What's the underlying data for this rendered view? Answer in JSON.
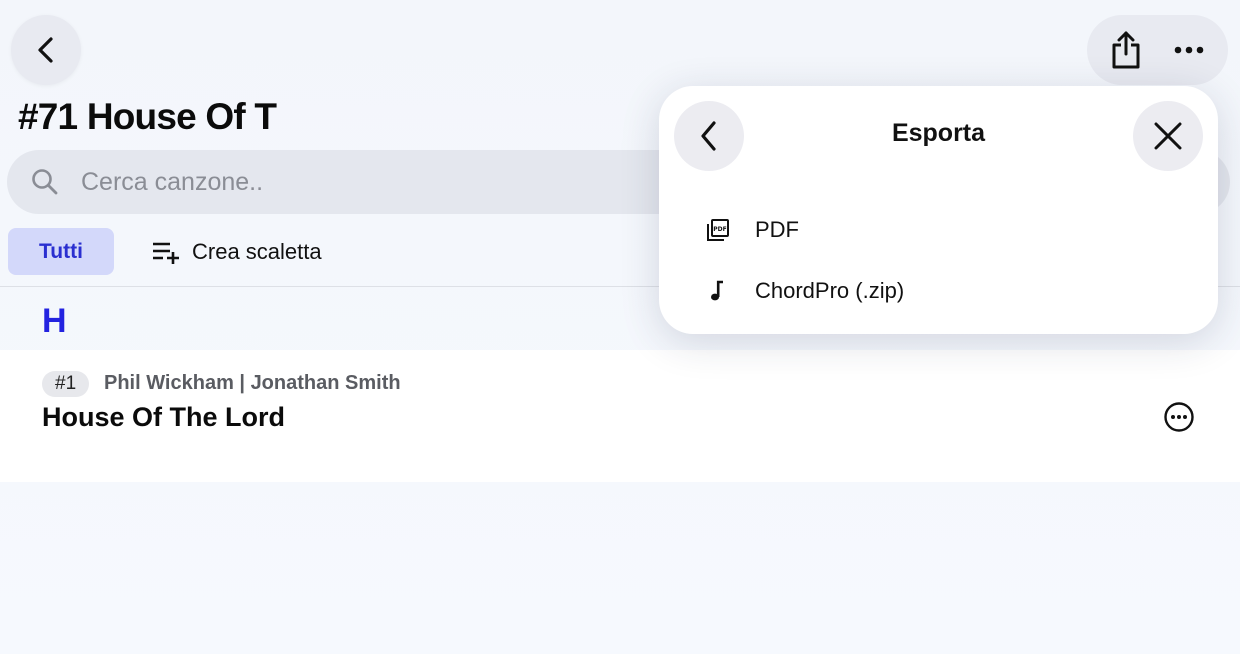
{
  "header": {
    "title": "#71 House Of T"
  },
  "search": {
    "placeholder": "Cerca canzone.."
  },
  "filters": {
    "all_label": "Tutti",
    "create_setlist_label": "Crea scaletta"
  },
  "list": {
    "section_letter": "H",
    "songs": [
      {
        "number": "#1",
        "artist": "Phil Wickham | Jonathan Smith",
        "title": "House Of The Lord"
      }
    ]
  },
  "export_menu": {
    "title": "Esporta",
    "items": [
      {
        "label": "PDF",
        "icon": "pdf-icon"
      },
      {
        "label": "ChordPro (.zip)",
        "icon": "music-note-icon"
      }
    ]
  },
  "colors": {
    "accent": "#2323e0",
    "chip_bg": "#d3d8fa"
  }
}
